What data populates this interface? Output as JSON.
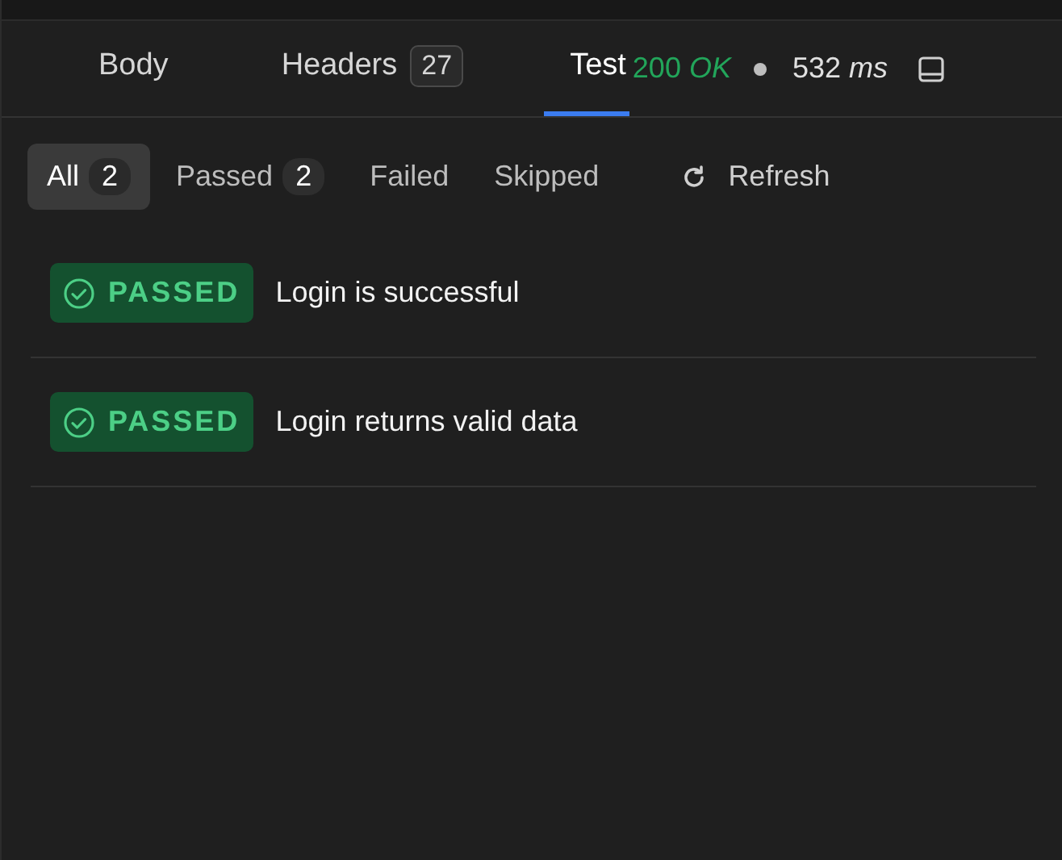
{
  "tabs": [
    {
      "label": "Body",
      "selected": false
    },
    {
      "label": "Headers",
      "count": "27",
      "selected": false
    },
    {
      "label": "Test",
      "selected": true
    }
  ],
  "status": {
    "code": "200 *OK*",
    "time": "532 *ms*"
  },
  "filters": [
    {
      "label": "All",
      "count": "2",
      "selected": true
    },
    {
      "label": "Passed",
      "count": "2",
      "selected": false
    },
    {
      "label": "Failed",
      "selected": false
    },
    {
      "label": "Skipped",
      "selected": false
    }
  ],
  "refresh": {
    "label": "Refresh"
  },
  "tests": [
    {
      "status": "PASSED",
      "kind": "passed",
      "name": "Login is successful"
    },
    {
      "status": "PASSED",
      "kind": "passed",
      "name": "Login returns valid data"
    }
  ]
}
